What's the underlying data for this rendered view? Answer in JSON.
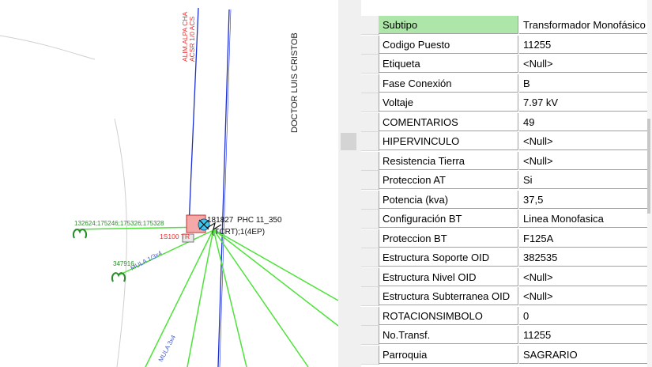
{
  "map": {
    "street_label": "DOCTOR LUIS CRISTOB",
    "feeder_label_1": "ALIM.ALPA CHA",
    "feeder_label_2": "ACSR 1/0 ACS",
    "ids_label": "132624;175246;175326;175328",
    "transformer_label": "1S100 TR",
    "id_347916": "347916",
    "mula_label": "MULA 1/3x4",
    "post_label_1": "PHC 11_350",
    "post_label_2": "(TCRT);1(4EP)",
    "post_number": "181827",
    "mula_label_2": "MULA 3x4",
    "colors": {
      "blue_line": "#1b2ed1",
      "green_line": "#4ee23a",
      "red_text": "#e83030",
      "green_text": "#2a8c2a"
    }
  },
  "attributes": {
    "rows": [
      {
        "name": "Subtipo",
        "value": "Transformador Monofásico"
      },
      {
        "name": "Codigo Puesto",
        "value": "11255"
      },
      {
        "name": "Etiqueta",
        "value": "<Null>"
      },
      {
        "name": "Fase Conexión",
        "value": "B"
      },
      {
        "name": "Voltaje",
        "value": "7.97 kV"
      },
      {
        "name": "COMENTARIOS",
        "value": "49"
      },
      {
        "name": "HIPERVINCULO",
        "value": "<Null>"
      },
      {
        "name": "Resistencia Tierra",
        "value": "<Null>"
      },
      {
        "name": "Proteccion AT",
        "value": "Si"
      },
      {
        "name": "Potencia (kva)",
        "value": "37,5"
      },
      {
        "name": "Configuración BT",
        "value": "Linea Monofasica"
      },
      {
        "name": "Proteccion BT",
        "value": "F125A"
      },
      {
        "name": "Estructura Soporte OID",
        "value": "382535"
      },
      {
        "name": "Estructura Nivel OID",
        "value": "<Null>"
      },
      {
        "name": "Estructura Subterranea OID",
        "value": "<Null>"
      },
      {
        "name": "ROTACIONSIMBOLO",
        "value": "0"
      },
      {
        "name": "No.Transf.",
        "value": "11255"
      },
      {
        "name": "Parroquia",
        "value": "SAGRARIO"
      }
    ]
  }
}
